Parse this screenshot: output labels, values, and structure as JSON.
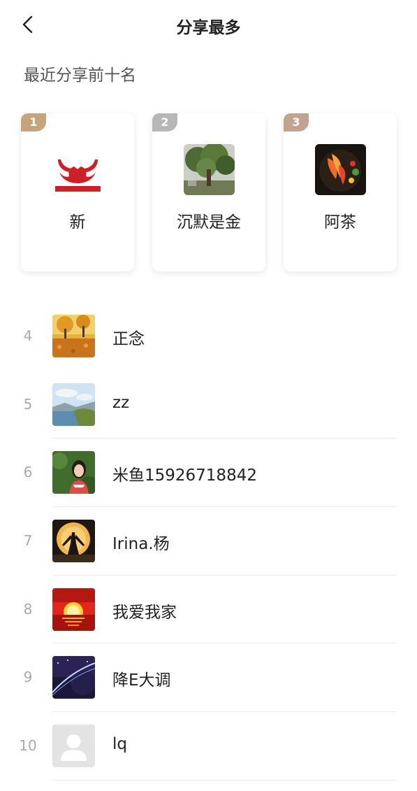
{
  "header": {
    "title": "分享最多"
  },
  "section_title": "最近分享前十名",
  "top3": [
    {
      "rank": "1",
      "name": "新",
      "badge_color": "#c4a57d",
      "avatar": "red-bull-logo"
    },
    {
      "rank": "2",
      "name": "沉默是金",
      "badge_color": "#b7b7b7",
      "avatar": "tree-photo"
    },
    {
      "rank": "3",
      "name": "阿茶",
      "badge_color": "#c1a392",
      "avatar": "phoenix-art"
    }
  ],
  "list": [
    {
      "rank": "4",
      "name": "正念",
      "avatar": "autumn-leaves"
    },
    {
      "rank": "5",
      "name": "zz",
      "avatar": "lake-landscape"
    },
    {
      "rank": "6",
      "name": "米鱼15926718842",
      "avatar": "woman-portrait"
    },
    {
      "rank": "7",
      "name": "Irina.杨",
      "avatar": "moon-silhouette"
    },
    {
      "rank": "8",
      "name": "我爱我家",
      "avatar": "sunset"
    },
    {
      "rank": "9",
      "name": "降E大调",
      "avatar": "space-planet"
    },
    {
      "rank": "10",
      "name": "lq",
      "avatar": "default-user"
    }
  ]
}
